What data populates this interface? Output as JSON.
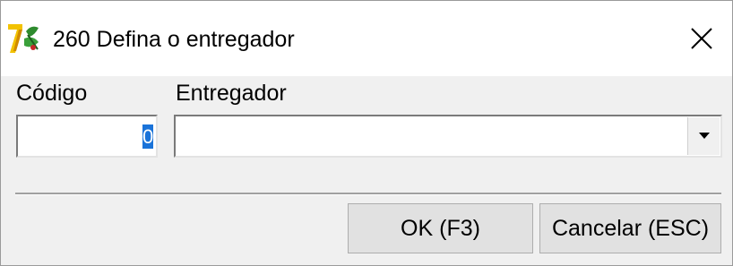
{
  "window": {
    "title": "260 Defina o entregador",
    "app_icon": "app-logo-icon",
    "close_icon": "close-icon"
  },
  "form": {
    "code_label": "Código",
    "code_value": "",
    "deliverer_label": "Entregador",
    "deliverer_value": "",
    "dropdown_icon": "chevron-down-icon"
  },
  "buttons": {
    "ok_label": "OK (F3)",
    "cancel_label": "Cancelar (ESC)"
  },
  "colors": {
    "client_bg": "#f0f0f0",
    "selection": "#1a73d9",
    "button_bg": "#e1e1e1"
  }
}
